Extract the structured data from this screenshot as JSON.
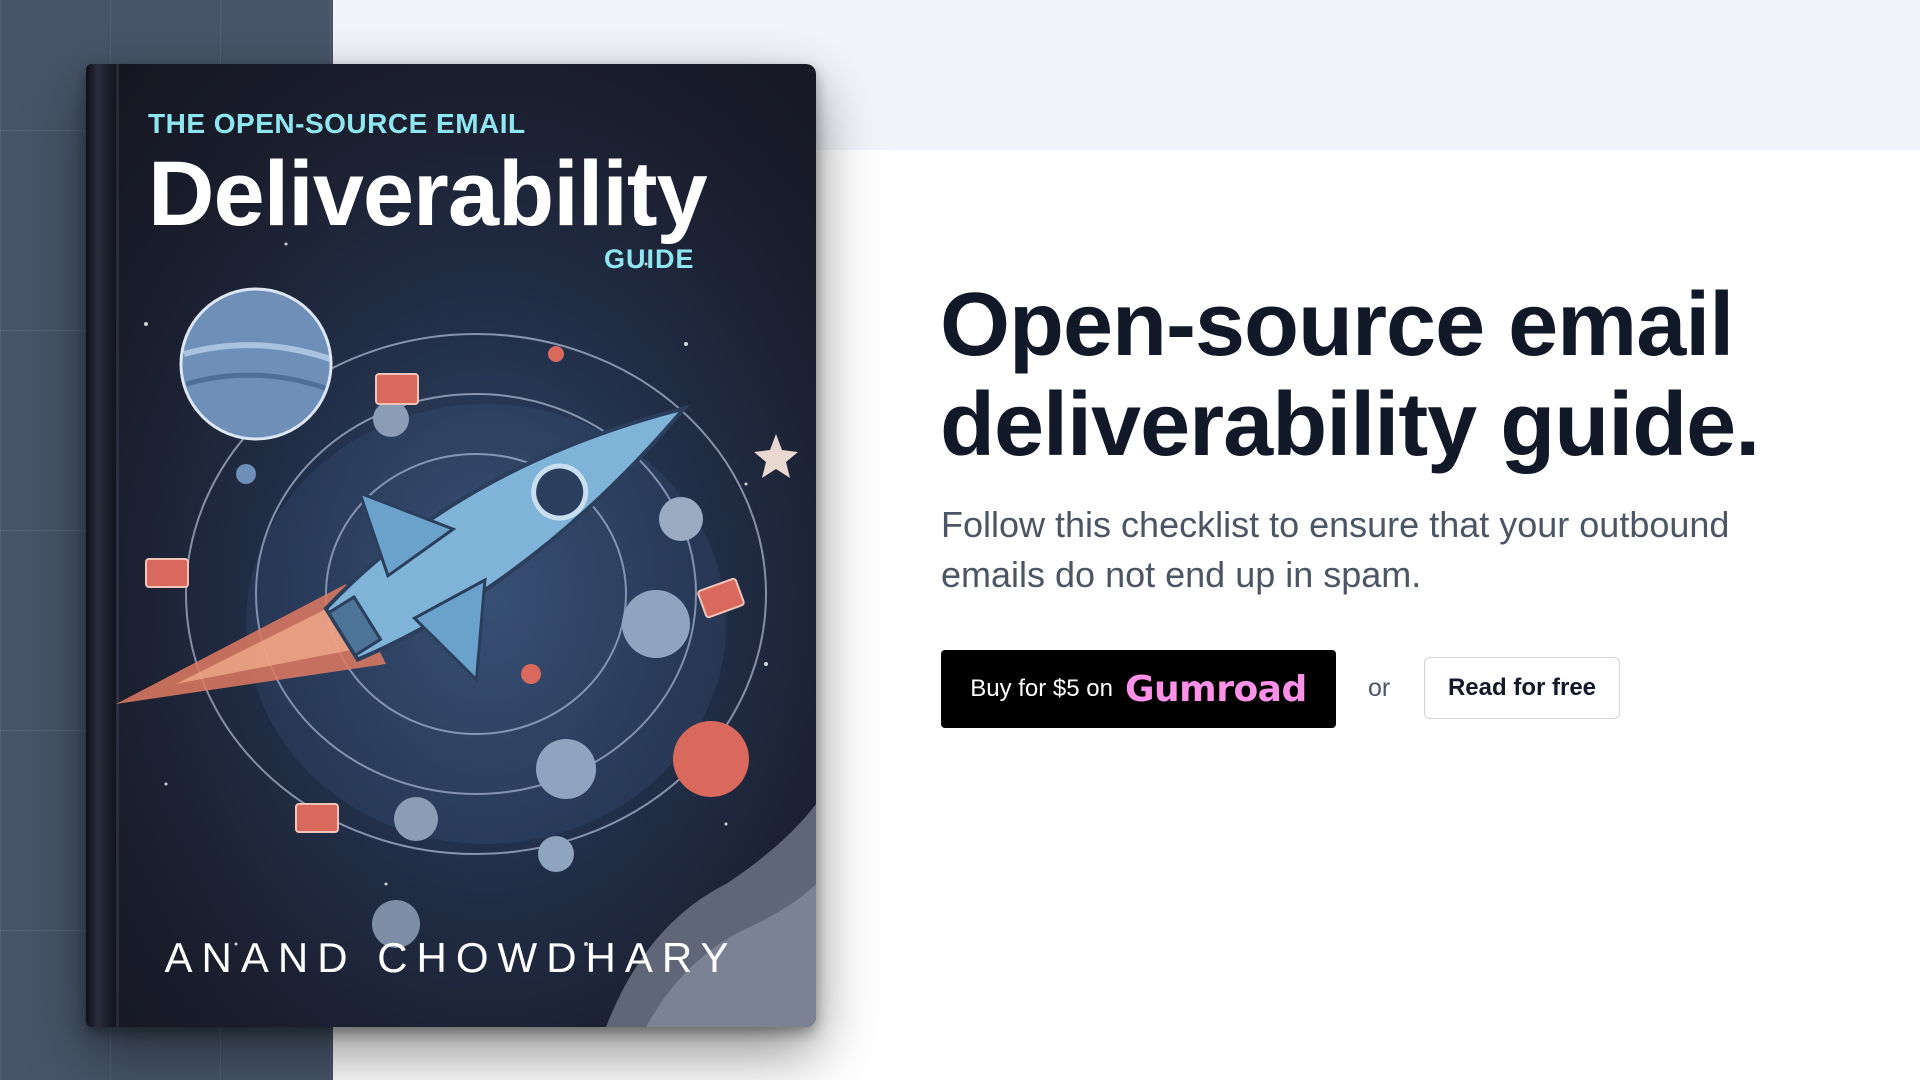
{
  "book": {
    "kicker": "THE OPEN-SOURCE EMAIL",
    "title": "Deliverability",
    "subtitle": "GUIDE",
    "author": "ANAND CHOWDHARY"
  },
  "hero": {
    "headline_line1": "Open-source email",
    "headline_line2": "deliverability guide.",
    "subtitle_line1": "Follow this checklist to ensure that your outbound",
    "subtitle_line2": "emails do not end up in spam."
  },
  "actions": {
    "buy_label": "Buy for $5 on",
    "buy_brand": "Gumroad",
    "or_text": "or",
    "read_label": "Read for free"
  },
  "colors": {
    "left_panel": "#475569",
    "top_band": "#f1f5f9",
    "headline": "#111827",
    "gumroad_pink": "#ff90e8",
    "book_accent": "#8ee7f0"
  }
}
